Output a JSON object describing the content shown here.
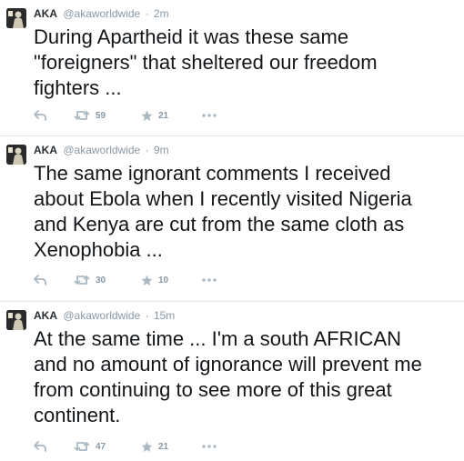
{
  "tweets": [
    {
      "name": "AKA",
      "handle": "@akaworldwide",
      "separator": "·",
      "time": "2m",
      "text": "During Apartheid it was these same\n\"foreigners\" that sheltered our freedom\nfighters ...",
      "retweets": "59",
      "favorites": "21"
    },
    {
      "name": "AKA",
      "handle": "@akaworldwide",
      "separator": "·",
      "time": "9m",
      "text": "The same ignorant comments I received\nabout Ebola when I recently visited Nigeria\nand Kenya are cut from the same cloth as\nXenophobia ...",
      "retweets": "30",
      "favorites": "10"
    },
    {
      "name": "AKA",
      "handle": "@akaworldwide",
      "separator": "·",
      "time": "15m",
      "text": "At the same time ... I'm a south AFRICAN\nand no amount of ignorance will prevent me\nfrom continuing to see more of this great\ncontinent.",
      "retweets": "47",
      "favorites": "21"
    }
  ],
  "icons": {
    "reply": "reply-icon",
    "retweet": "retweet-icon",
    "favorite": "star-icon",
    "more": "more-icon"
  },
  "colors": {
    "text": "#14171a",
    "muted": "#8899a6",
    "divider": "#e1e8ed"
  }
}
